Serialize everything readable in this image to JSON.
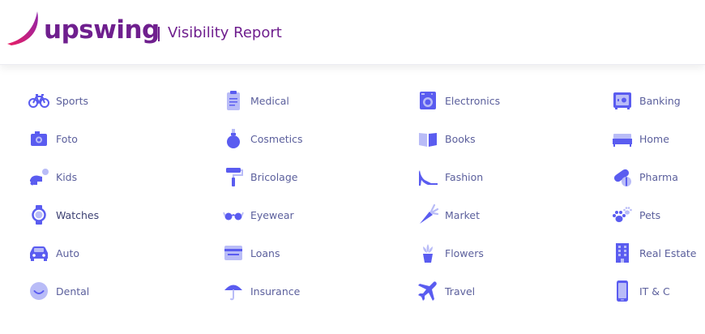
{
  "header": {
    "logo_text": "upswing",
    "title": "Visibility Report"
  },
  "colors": {
    "brand": "#6f1f8e",
    "icon_primary": "#5a5cf0",
    "icon_light": "#b9bcf7",
    "label": "#5b5f9c"
  },
  "categories": [
    {
      "label": "Sports",
      "icon": "bicycle-icon"
    },
    {
      "label": "Foto",
      "icon": "camera-icon"
    },
    {
      "label": "Kids",
      "icon": "toy-icon"
    },
    {
      "label": "Watches",
      "icon": "watch-icon"
    },
    {
      "label": "Auto",
      "icon": "car-icon"
    },
    {
      "label": "Dental",
      "icon": "smile-icon"
    },
    {
      "label": "Medical",
      "icon": "clipboard-icon"
    },
    {
      "label": "Cosmetics",
      "icon": "perfume-icon"
    },
    {
      "label": "Bricolage",
      "icon": "paint-roller-icon"
    },
    {
      "label": "Eyewear",
      "icon": "glasses-icon"
    },
    {
      "label": "Loans",
      "icon": "wallet-icon"
    },
    {
      "label": "Insurance",
      "icon": "umbrella-icon"
    },
    {
      "label": "Electronics",
      "icon": "washing-machine-icon"
    },
    {
      "label": "Books",
      "icon": "book-icon"
    },
    {
      "label": "Fashion",
      "icon": "high-heel-icon"
    },
    {
      "label": "Market",
      "icon": "carrot-icon"
    },
    {
      "label": "Flowers",
      "icon": "flower-pot-icon"
    },
    {
      "label": "Travel",
      "icon": "airplane-icon"
    },
    {
      "label": "Banking",
      "icon": "safe-icon"
    },
    {
      "label": "Home",
      "icon": "bed-icon"
    },
    {
      "label": "Pharma",
      "icon": "pills-icon"
    },
    {
      "label": "Pets",
      "icon": "paw-icon"
    },
    {
      "label": "Real Estate",
      "icon": "building-icon"
    },
    {
      "label": "IT & C",
      "icon": "smartphone-icon"
    }
  ]
}
